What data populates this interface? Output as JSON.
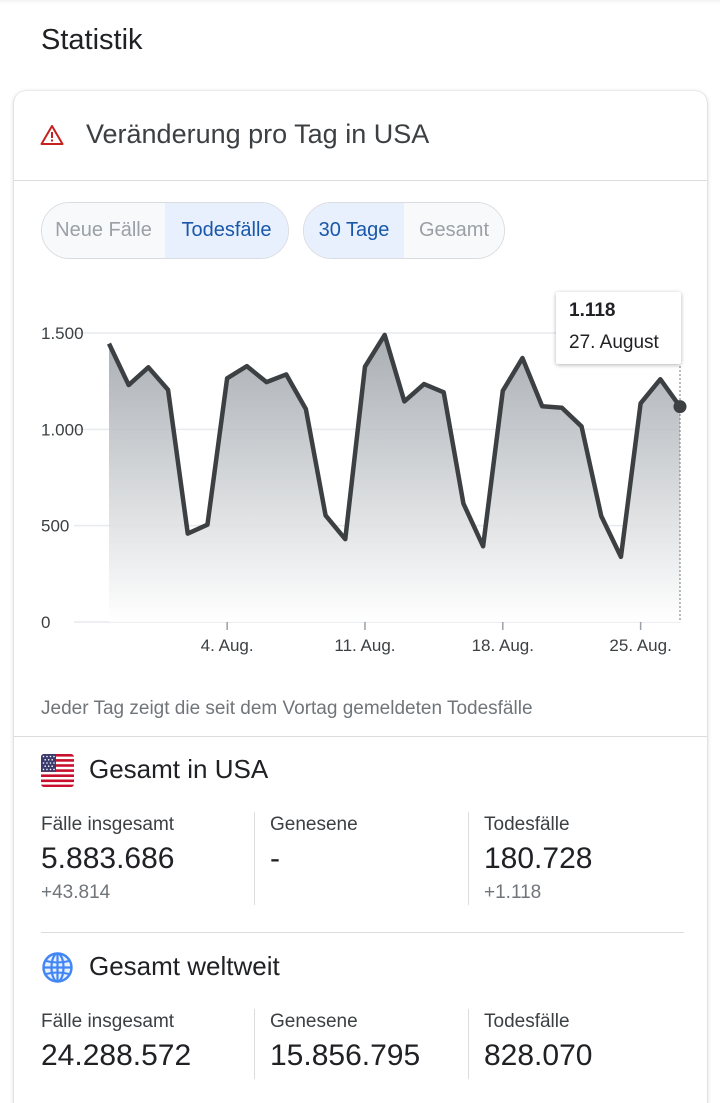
{
  "page": {
    "title": "Statistik"
  },
  "card": {
    "title": "Veränderung pro Tag in USA",
    "icon": "warning-triangle-icon",
    "accent_color": "#c5221f"
  },
  "metric_toggle": {
    "options": [
      "Neue Fälle",
      "Todesfälle"
    ],
    "selected": "Todesfälle"
  },
  "range_toggle": {
    "options": [
      "30 Tage",
      "Gesamt"
    ],
    "selected": "30 Tage"
  },
  "tooltip": {
    "value": "1.118",
    "date": "27. August"
  },
  "caption": "Jeder Tag zeigt die seit dem Vortag gemeldeten Todesfälle",
  "chart_data": {
    "type": "area",
    "x": [
      "29. Juli",
      "30. Juli",
      "31. Juli",
      "1. Aug.",
      "2. Aug.",
      "3. Aug.",
      "4. Aug.",
      "5. Aug.",
      "6. Aug.",
      "7. Aug.",
      "8. Aug.",
      "9. Aug.",
      "10. Aug.",
      "11. Aug.",
      "12. Aug.",
      "13. Aug.",
      "14. Aug.",
      "15. Aug.",
      "16. Aug.",
      "17. Aug.",
      "18. Aug.",
      "19. Aug.",
      "20. Aug.",
      "21. Aug.",
      "22. Aug.",
      "23. Aug.",
      "24. Aug.",
      "25. Aug.",
      "26. Aug.",
      "27. Aug."
    ],
    "values": [
      1445,
      1230,
      1322,
      1205,
      459,
      505,
      1265,
      1328,
      1245,
      1285,
      1105,
      553,
      430,
      1325,
      1490,
      1145,
      1235,
      1192,
      615,
      393,
      1200,
      1370,
      1120,
      1112,
      1015,
      550,
      338,
      1135,
      1260,
      1118
    ],
    "x_ticks": [
      "4. Aug.",
      "11. Aug.",
      "18. Aug.",
      "25. Aug."
    ],
    "y_ticks": [
      "1.500",
      "1.000",
      "500",
      "0"
    ],
    "ylim": [
      0,
      1500
    ],
    "line_color": "#3c4043",
    "grid": true
  },
  "usa": {
    "title": "Gesamt in USA",
    "icon": "us-flag-icon",
    "stats": [
      {
        "label": "Fälle insgesamt",
        "value": "5.883.686",
        "delta": "+43.814"
      },
      {
        "label": "Genesene",
        "value": "-",
        "delta": ""
      },
      {
        "label": "Todesfälle",
        "value": "180.728",
        "delta": "+1.118"
      }
    ]
  },
  "world": {
    "title": "Gesamt weltweit",
    "icon": "globe-icon",
    "stats": [
      {
        "label": "Fälle insgesamt",
        "value": "24.288.572"
      },
      {
        "label": "Genesene",
        "value": "15.856.795"
      },
      {
        "label": "Todesfälle",
        "value": "828.070"
      }
    ]
  }
}
